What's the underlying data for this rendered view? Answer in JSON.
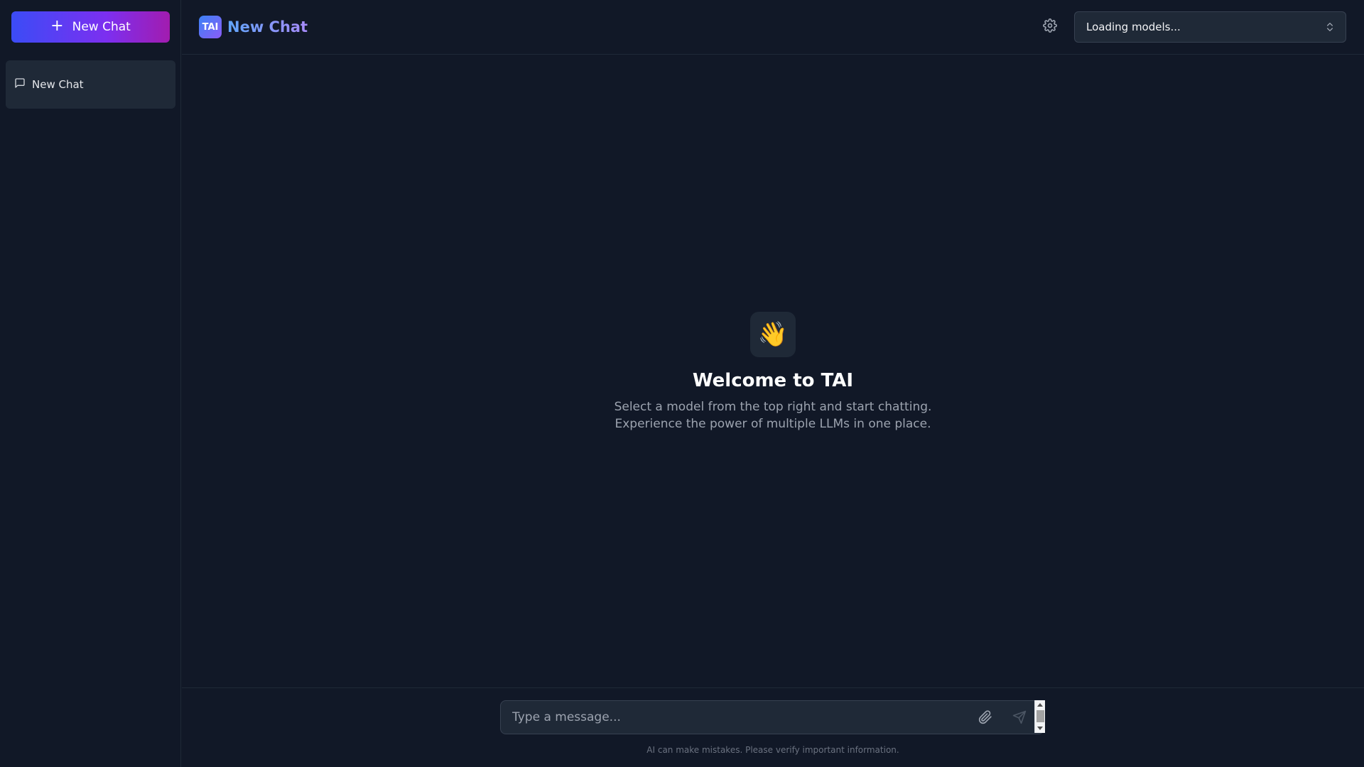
{
  "sidebar": {
    "new_chat_button": {
      "label": "New Chat",
      "icon": "plus-icon"
    },
    "chats": [
      {
        "label": "New Chat",
        "icon": "message-square-icon",
        "active": true
      }
    ]
  },
  "header": {
    "logo_text": "TAI",
    "title": "New Chat",
    "settings_icon": "gear-icon",
    "model_select": {
      "value": "Loading models...",
      "icon": "chevrons-up-down-icon"
    }
  },
  "welcome": {
    "emoji": "👋",
    "title": "Welcome to TAI",
    "line1": "Select a model from the top right and start chatting.",
    "line2": "Experience the power of multiple LLMs in one place."
  },
  "composer": {
    "placeholder": "Type a message...",
    "value": "",
    "attach_icon": "paperclip-icon",
    "send_icon": "send-icon",
    "disclaimer": "AI can make mistakes. Please verify important information."
  },
  "colors": {
    "background": "#111827",
    "surface": "#1f2937",
    "border": "#374151",
    "accent_start": "#3b4cf6",
    "accent_end": "#a21caf"
  }
}
